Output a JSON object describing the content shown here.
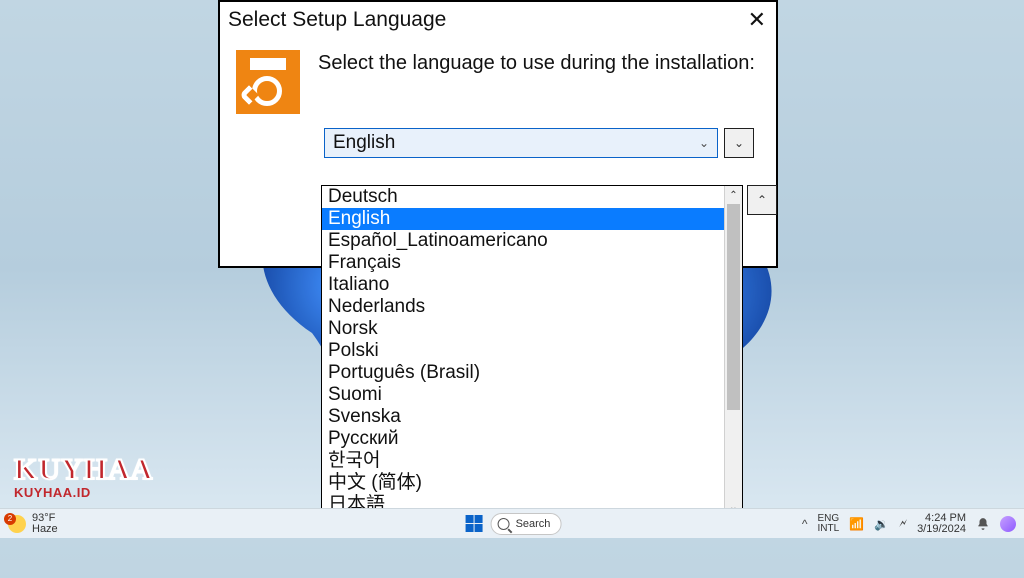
{
  "dialog": {
    "title": "Select Setup Language",
    "prompt": "Select the language to use during the installation:",
    "selected_value": "English",
    "options": [
      "Deutsch",
      "English",
      "Español_Latinoamericano",
      "Français",
      "Italiano",
      "Nederlands",
      "Norsk",
      "Polski",
      "Português (Brasil)",
      "Suomi",
      "Svenska",
      "Русский",
      "한국어",
      "中文 (简体)",
      "日本語"
    ],
    "selected_index": 1
  },
  "taskbar": {
    "weather": {
      "temp": "93°F",
      "desc": "Haze",
      "badge": "2"
    },
    "search_placeholder": "Search",
    "lang": {
      "line1": "ENG",
      "line2": "INTL"
    },
    "clock": {
      "time": "4:24 PM",
      "date": "3/19/2024"
    }
  },
  "watermark": {
    "big": "KUYHAA",
    "small": "KUYHAA.ID"
  },
  "glyphs": {
    "chev_down": "⌄",
    "chev_up": "⌃",
    "close": "✕",
    "tray_up": "^",
    "wifi": "⋐",
    "speaker": "🔊",
    "battery": "🔋"
  }
}
